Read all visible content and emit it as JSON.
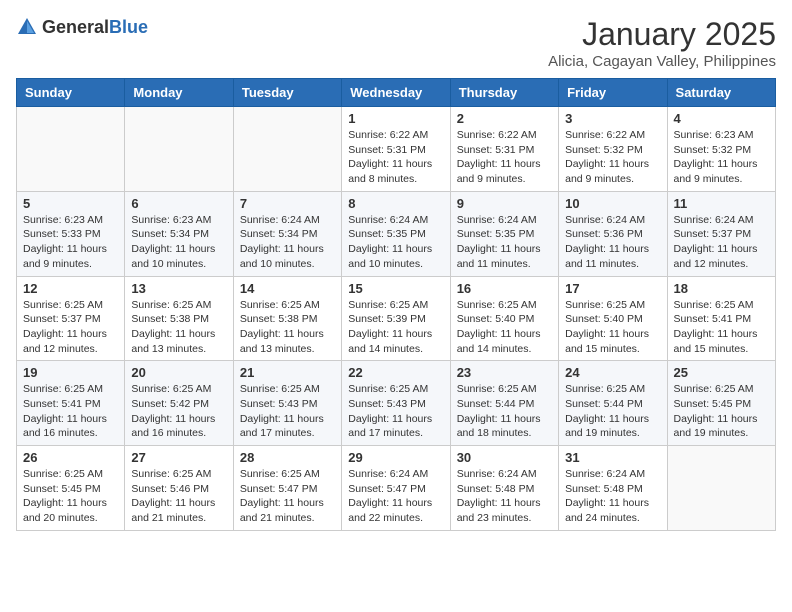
{
  "header": {
    "logo_general": "General",
    "logo_blue": "Blue",
    "title": "January 2025",
    "subtitle": "Alicia, Cagayan Valley, Philippines"
  },
  "weekdays": [
    "Sunday",
    "Monday",
    "Tuesday",
    "Wednesday",
    "Thursday",
    "Friday",
    "Saturday"
  ],
  "weeks": [
    [
      {
        "day": "",
        "sunrise": "",
        "sunset": "",
        "daylight": ""
      },
      {
        "day": "",
        "sunrise": "",
        "sunset": "",
        "daylight": ""
      },
      {
        "day": "",
        "sunrise": "",
        "sunset": "",
        "daylight": ""
      },
      {
        "day": "1",
        "sunrise": "Sunrise: 6:22 AM",
        "sunset": "Sunset: 5:31 PM",
        "daylight": "Daylight: 11 hours and 8 minutes."
      },
      {
        "day": "2",
        "sunrise": "Sunrise: 6:22 AM",
        "sunset": "Sunset: 5:31 PM",
        "daylight": "Daylight: 11 hours and 9 minutes."
      },
      {
        "day": "3",
        "sunrise": "Sunrise: 6:22 AM",
        "sunset": "Sunset: 5:32 PM",
        "daylight": "Daylight: 11 hours and 9 minutes."
      },
      {
        "day": "4",
        "sunrise": "Sunrise: 6:23 AM",
        "sunset": "Sunset: 5:32 PM",
        "daylight": "Daylight: 11 hours and 9 minutes."
      }
    ],
    [
      {
        "day": "5",
        "sunrise": "Sunrise: 6:23 AM",
        "sunset": "Sunset: 5:33 PM",
        "daylight": "Daylight: 11 hours and 9 minutes."
      },
      {
        "day": "6",
        "sunrise": "Sunrise: 6:23 AM",
        "sunset": "Sunset: 5:34 PM",
        "daylight": "Daylight: 11 hours and 10 minutes."
      },
      {
        "day": "7",
        "sunrise": "Sunrise: 6:24 AM",
        "sunset": "Sunset: 5:34 PM",
        "daylight": "Daylight: 11 hours and 10 minutes."
      },
      {
        "day": "8",
        "sunrise": "Sunrise: 6:24 AM",
        "sunset": "Sunset: 5:35 PM",
        "daylight": "Daylight: 11 hours and 10 minutes."
      },
      {
        "day": "9",
        "sunrise": "Sunrise: 6:24 AM",
        "sunset": "Sunset: 5:35 PM",
        "daylight": "Daylight: 11 hours and 11 minutes."
      },
      {
        "day": "10",
        "sunrise": "Sunrise: 6:24 AM",
        "sunset": "Sunset: 5:36 PM",
        "daylight": "Daylight: 11 hours and 11 minutes."
      },
      {
        "day": "11",
        "sunrise": "Sunrise: 6:24 AM",
        "sunset": "Sunset: 5:37 PM",
        "daylight": "Daylight: 11 hours and 12 minutes."
      }
    ],
    [
      {
        "day": "12",
        "sunrise": "Sunrise: 6:25 AM",
        "sunset": "Sunset: 5:37 PM",
        "daylight": "Daylight: 11 hours and 12 minutes."
      },
      {
        "day": "13",
        "sunrise": "Sunrise: 6:25 AM",
        "sunset": "Sunset: 5:38 PM",
        "daylight": "Daylight: 11 hours and 13 minutes."
      },
      {
        "day": "14",
        "sunrise": "Sunrise: 6:25 AM",
        "sunset": "Sunset: 5:38 PM",
        "daylight": "Daylight: 11 hours and 13 minutes."
      },
      {
        "day": "15",
        "sunrise": "Sunrise: 6:25 AM",
        "sunset": "Sunset: 5:39 PM",
        "daylight": "Daylight: 11 hours and 14 minutes."
      },
      {
        "day": "16",
        "sunrise": "Sunrise: 6:25 AM",
        "sunset": "Sunset: 5:40 PM",
        "daylight": "Daylight: 11 hours and 14 minutes."
      },
      {
        "day": "17",
        "sunrise": "Sunrise: 6:25 AM",
        "sunset": "Sunset: 5:40 PM",
        "daylight": "Daylight: 11 hours and 15 minutes."
      },
      {
        "day": "18",
        "sunrise": "Sunrise: 6:25 AM",
        "sunset": "Sunset: 5:41 PM",
        "daylight": "Daylight: 11 hours and 15 minutes."
      }
    ],
    [
      {
        "day": "19",
        "sunrise": "Sunrise: 6:25 AM",
        "sunset": "Sunset: 5:41 PM",
        "daylight": "Daylight: 11 hours and 16 minutes."
      },
      {
        "day": "20",
        "sunrise": "Sunrise: 6:25 AM",
        "sunset": "Sunset: 5:42 PM",
        "daylight": "Daylight: 11 hours and 16 minutes."
      },
      {
        "day": "21",
        "sunrise": "Sunrise: 6:25 AM",
        "sunset": "Sunset: 5:43 PM",
        "daylight": "Daylight: 11 hours and 17 minutes."
      },
      {
        "day": "22",
        "sunrise": "Sunrise: 6:25 AM",
        "sunset": "Sunset: 5:43 PM",
        "daylight": "Daylight: 11 hours and 17 minutes."
      },
      {
        "day": "23",
        "sunrise": "Sunrise: 6:25 AM",
        "sunset": "Sunset: 5:44 PM",
        "daylight": "Daylight: 11 hours and 18 minutes."
      },
      {
        "day": "24",
        "sunrise": "Sunrise: 6:25 AM",
        "sunset": "Sunset: 5:44 PM",
        "daylight": "Daylight: 11 hours and 19 minutes."
      },
      {
        "day": "25",
        "sunrise": "Sunrise: 6:25 AM",
        "sunset": "Sunset: 5:45 PM",
        "daylight": "Daylight: 11 hours and 19 minutes."
      }
    ],
    [
      {
        "day": "26",
        "sunrise": "Sunrise: 6:25 AM",
        "sunset": "Sunset: 5:45 PM",
        "daylight": "Daylight: 11 hours and 20 minutes."
      },
      {
        "day": "27",
        "sunrise": "Sunrise: 6:25 AM",
        "sunset": "Sunset: 5:46 PM",
        "daylight": "Daylight: 11 hours and 21 minutes."
      },
      {
        "day": "28",
        "sunrise": "Sunrise: 6:25 AM",
        "sunset": "Sunset: 5:47 PM",
        "daylight": "Daylight: 11 hours and 21 minutes."
      },
      {
        "day": "29",
        "sunrise": "Sunrise: 6:24 AM",
        "sunset": "Sunset: 5:47 PM",
        "daylight": "Daylight: 11 hours and 22 minutes."
      },
      {
        "day": "30",
        "sunrise": "Sunrise: 6:24 AM",
        "sunset": "Sunset: 5:48 PM",
        "daylight": "Daylight: 11 hours and 23 minutes."
      },
      {
        "day": "31",
        "sunrise": "Sunrise: 6:24 AM",
        "sunset": "Sunset: 5:48 PM",
        "daylight": "Daylight: 11 hours and 24 minutes."
      },
      {
        "day": "",
        "sunrise": "",
        "sunset": "",
        "daylight": ""
      }
    ]
  ]
}
